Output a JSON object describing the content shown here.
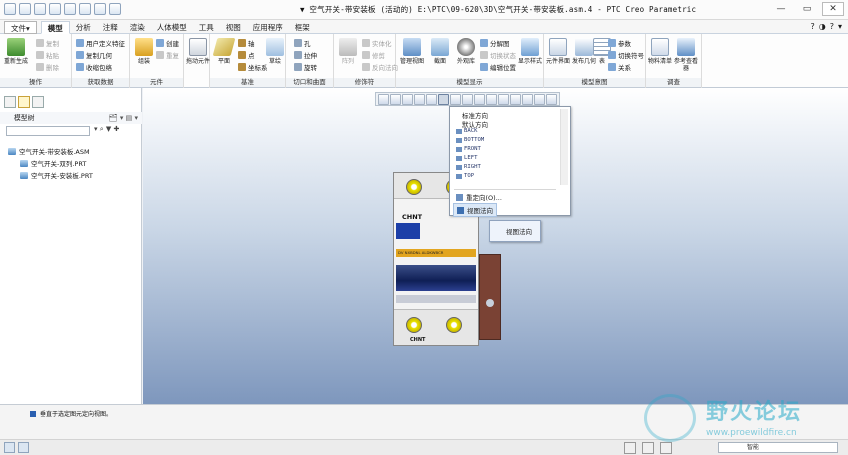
{
  "window": {
    "title": "▼ 空气开关-带安装板 (活动的) E:\\PTC\\09-620\\3D\\空气开关-带安装板.asm.4 - PTC Creo Parametric"
  },
  "tabs": [
    {
      "label": "文件▾"
    },
    {
      "label": "模型"
    },
    {
      "label": "分析"
    },
    {
      "label": "注释"
    },
    {
      "label": "渲染"
    },
    {
      "label": "人体模型"
    },
    {
      "label": "工具"
    },
    {
      "label": "视图"
    },
    {
      "label": "应用程序"
    },
    {
      "label": "框架"
    }
  ],
  "ribbon": {
    "regen": "重新生成",
    "copy": "复制",
    "paste": "粘贴",
    "delete": "删除",
    "user_feature": "用户定义特征",
    "copy_geom": "复制几何",
    "shrinkwrap": "收缩包络",
    "assemble": "组装",
    "create": "创建",
    "repeat": "重复",
    "drag": "拖动元件",
    "plane": "平面",
    "axis": "轴",
    "point": "点",
    "coord": "坐标系",
    "sketch": "草绘",
    "hole": "孔",
    "extrude": "拉伸",
    "revolve": "旋转",
    "solidify": "实体化",
    "trim": "修剪",
    "offset": "反向法向",
    "pattern": "阵列",
    "manage_views": "管理视图",
    "section": "截面",
    "appearance": "外观库",
    "explode": "分解图",
    "toggle_status": "切换状态",
    "edit_position": "编辑位置",
    "display_style": "显示样式",
    "component_interface": "元件界面",
    "publish_geom": "发布几何",
    "table": "表",
    "params": "参数",
    "switch_symbol": "切换符号",
    "relations": "关系",
    "bom": "物料清单",
    "reference_viewer": "参考查看器",
    "groups": [
      "操作",
      "获取数据",
      "元件",
      "基准",
      "切口和曲面",
      "修饰符",
      "模型显示",
      "模型意图",
      "调查"
    ]
  },
  "help_icons": [
    "?",
    "◑",
    "?",
    "▾"
  ],
  "tree": {
    "header": "模型树",
    "header_icons": "🗂 ▾ ▤ ▾",
    "tools": "▾  ⌕  ▼  ✚",
    "items": [
      {
        "label": "空气开关-带安装板.ASM"
      },
      {
        "label": "空气开关-双列.PRT"
      },
      {
        "label": "空气开关-安装板.PRT"
      }
    ]
  },
  "breaker": {
    "brand": "CHNT",
    "band_text": "DV NXBDNL  ALDKWBCR",
    "brand_bottom": "CHNT"
  },
  "orient_menu": {
    "items": [
      {
        "label": "标准方向"
      },
      {
        "label": "默认方向"
      },
      {
        "label": "BACK"
      },
      {
        "label": "BOTTOM"
      },
      {
        "label": "FRONT"
      },
      {
        "label": "LEFT"
      },
      {
        "label": "RIGHT"
      },
      {
        "label": "TOP"
      }
    ],
    "reorient": "重定向(O)...",
    "view_normal": "视图法向"
  },
  "tooltip": "视图法向",
  "status": {
    "message": "垂直于选定图元定向视图。",
    "filter": "智能"
  },
  "watermark": {
    "text": "野火论坛",
    "url": "www.proewildfire.cn"
  }
}
